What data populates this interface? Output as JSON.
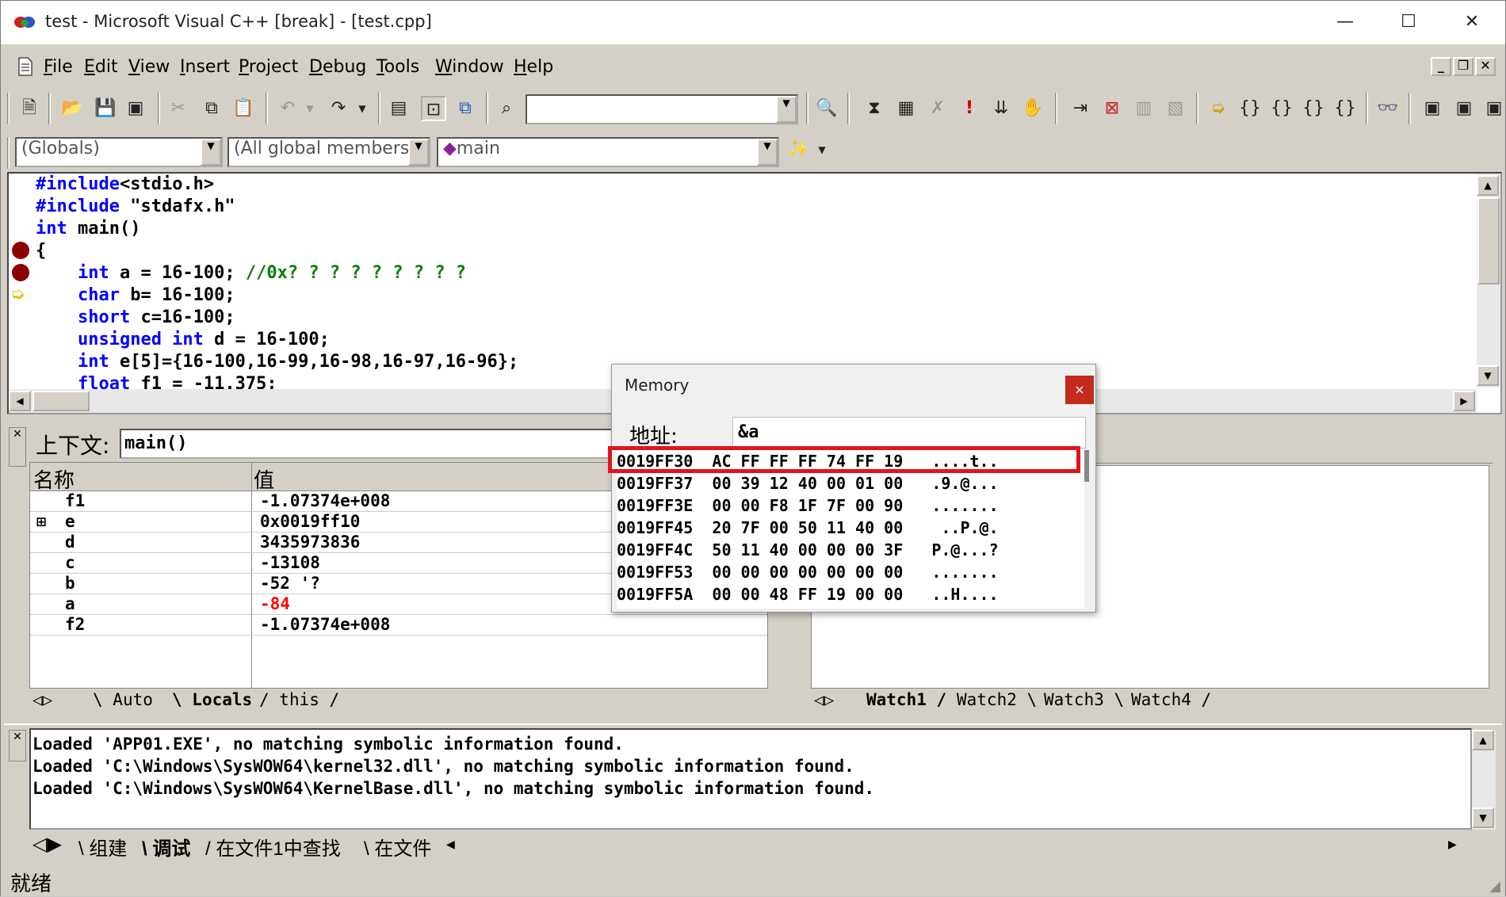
{
  "window": {
    "title": "test - Microsoft Visual C++ [break] - [test.cpp]",
    "minimize": "—",
    "maximize": "☐",
    "close": "✕"
  },
  "menu": [
    "File",
    "Edit",
    "View",
    "Insert",
    "Project",
    "Debug",
    "Tools",
    "Window",
    "Help"
  ],
  "menu_access_keys": [
    "F",
    "E",
    "V",
    "I",
    "P",
    "D",
    "T",
    "W",
    "H"
  ],
  "wizard": {
    "class_combo": "(Globals)",
    "filter_combo": "(All global members",
    "member_combo": "main"
  },
  "code_lines": [
    {
      "kw": "#include",
      "rest": "<stdio.h>"
    },
    {
      "kw": "#include",
      "rest": " \"stdafx.h\""
    },
    {
      "kw": "int",
      "rest": " main()"
    },
    {
      "kw": "",
      "rest": "{"
    },
    {
      "kw": "    int",
      "rest": " a = 16-100; ",
      "comment": "//0x? ? ? ? ? ? ? ? ?"
    },
    {
      "kw": "    char",
      "rest": " b= 16-100;"
    },
    {
      "kw": "    short",
      "rest": " c=16-100;"
    },
    {
      "kw": "    unsigned int",
      "rest": " d = 16-100;"
    },
    {
      "kw": "    int",
      "rest": " e[5]={16-100,16-99,16-98,16-97,16-96};"
    },
    {
      "kw": "    float",
      "rest": " f1 = -11.375;"
    }
  ],
  "variables": {
    "context_label": "上下文:",
    "context_value": "main()",
    "headers": {
      "name": "名称",
      "value": "值"
    },
    "rows": [
      {
        "name": "f1",
        "value": "-1.07374e+008",
        "changed": false,
        "expand": ""
      },
      {
        "name": "e",
        "value": "0x0019ff10",
        "changed": false,
        "expand": "⊞"
      },
      {
        "name": "d",
        "value": "3435973836",
        "changed": false,
        "expand": ""
      },
      {
        "name": "c",
        "value": "-13108",
        "changed": false,
        "expand": ""
      },
      {
        "name": "b",
        "value": "-52 '?",
        "changed": false,
        "expand": ""
      },
      {
        "name": "a",
        "value": "-84",
        "changed": true,
        "expand": ""
      },
      {
        "name": "f2",
        "value": "-1.07374e+008",
        "changed": false,
        "expand": ""
      }
    ],
    "tabs": [
      "Auto",
      "Locals",
      "this"
    ]
  },
  "watch_tabs": [
    "Watch1",
    "Watch2",
    "Watch3",
    "Watch4"
  ],
  "output_lines": [
    "Loaded 'APP01.EXE', no matching symbolic information found.",
    "Loaded 'C:\\Windows\\SysWOW64\\kernel32.dll', no matching symbolic information found.",
    "Loaded 'C:\\Windows\\SysWOW64\\KernelBase.dll', no matching symbolic information found."
  ],
  "output_tabs": [
    "组建",
    "调试",
    "在文件1中查找",
    "在文件"
  ],
  "status": "就绪",
  "memory": {
    "title": "Memory",
    "close": "×",
    "address_label": "地址:",
    "address_value": "&a",
    "rows": [
      "0019FF30  AC FF FF FF 74 FF 19   ....t..",
      "0019FF37  00 39 12 40 00 01 00   .9.@...",
      "0019FF3E  00 00 F8 1F 7F 00 90   .......",
      "0019FF45  20 7F 00 50 11 40 00    ..P.@.",
      "0019FF4C  50 11 40 00 00 00 3F   P.@...?",
      "0019FF53  00 00 00 00 00 00 00   .......",
      "0019FF5A  00 00 48 FF 19 00 00   ..H...."
    ]
  },
  "colors": {
    "changed_value": "#ff0000",
    "highlight": "#e0141e",
    "keyword": "#0000ff",
    "comment": "#008000",
    "breakpoint": "#8b0000"
  }
}
